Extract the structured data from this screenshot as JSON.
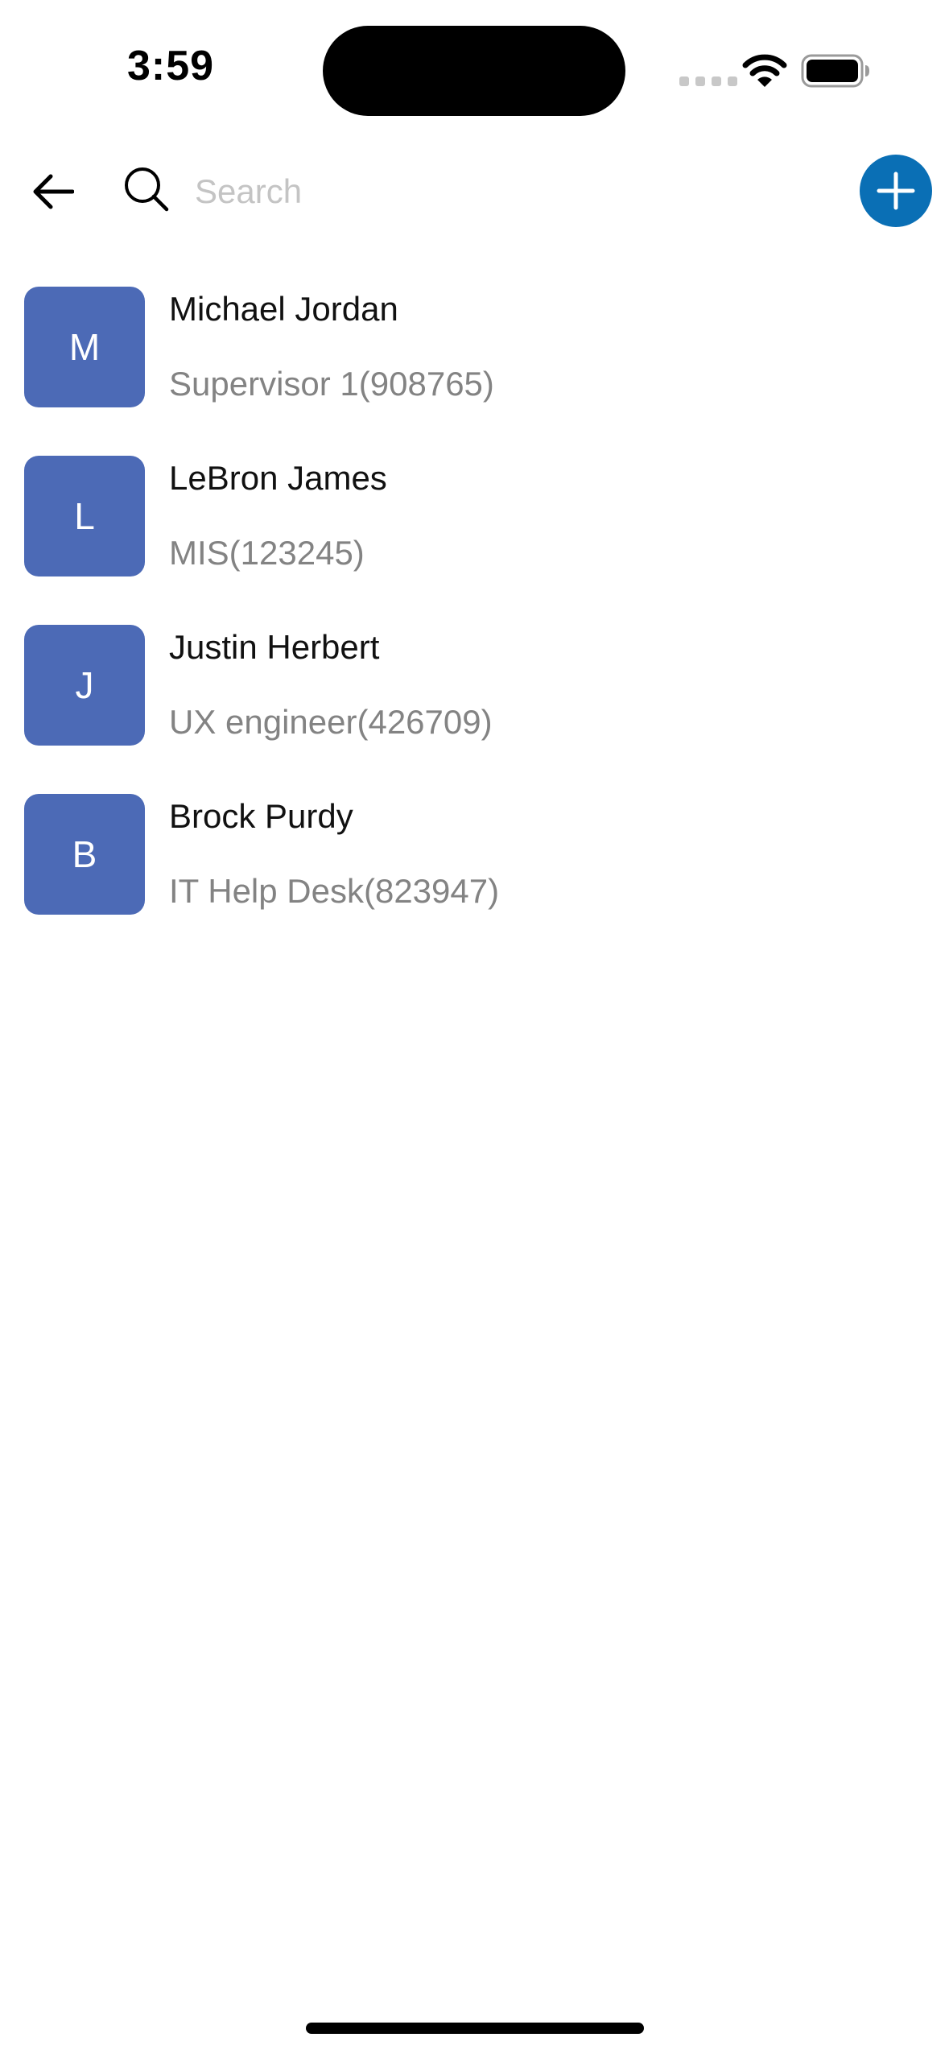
{
  "status_bar": {
    "time": "3:59",
    "icons": [
      "signal-dots-icon",
      "wifi-icon",
      "battery-icon"
    ]
  },
  "top_bar": {
    "back_icon": "arrow-left-icon",
    "search_icon": "search-icon",
    "search_placeholder": "Search",
    "search_value": "",
    "add_icon": "plus-icon"
  },
  "colors": {
    "avatar_bg": "#4c6ab6",
    "add_button_bg": "#0a6fb5",
    "secondary_text": "#838383",
    "placeholder_text": "#c4c4c4"
  },
  "contacts": [
    {
      "initial": "M",
      "name": "Michael Jordan",
      "role": "Supervisor 1(908765)"
    },
    {
      "initial": "L",
      "name": "LeBron James",
      "role": "MIS(123245)"
    },
    {
      "initial": "J",
      "name": "Justin Herbert",
      "role": "UX engineer(426709)"
    },
    {
      "initial": "B",
      "name": "Brock Purdy",
      "role": "IT Help Desk(823947)"
    }
  ]
}
